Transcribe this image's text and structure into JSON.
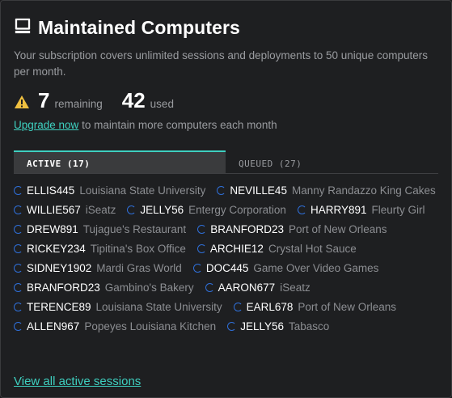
{
  "header": {
    "title": "Maintained Computers",
    "icon": "computer-icon"
  },
  "description": "Your subscription covers unlimited sessions and deployments to 50 unique computers per month.",
  "stats": {
    "remaining": "7",
    "remaining_label": "remaining",
    "used": "42",
    "used_label": "used",
    "warning_color": "#f0c040"
  },
  "upgrade": {
    "link": "Upgrade now",
    "text": " to maintain more computers each month"
  },
  "tabs": [
    {
      "label": "ACTIVE (17)"
    },
    {
      "label": "QUEUED (27)"
    }
  ],
  "accent_color": "#3ed0c0",
  "sessions": [
    {
      "name": "ELLIS445",
      "org": "Louisiana State University"
    },
    {
      "name": "NEVILLE45",
      "org": "Manny Randazzo King Cakes"
    },
    {
      "name": "WILLIE567",
      "org": "iSeatz"
    },
    {
      "name": "JELLY56",
      "org": "Entergy Corporation"
    },
    {
      "name": "HARRY891",
      "org": "Fleurty Girl"
    },
    {
      "name": "DREW891",
      "org": "Tujague's Restaurant"
    },
    {
      "name": "BRANFORD23",
      "org": "Port of New Orleans"
    },
    {
      "name": "RICKEY234",
      "org": "Tipitina's Box Office"
    },
    {
      "name": "ARCHIE12",
      "org": "Crystal Hot Sauce"
    },
    {
      "name": "SIDNEY1902",
      "org": "Mardi Gras World"
    },
    {
      "name": "DOC445",
      "org": "Game Over Video Games"
    },
    {
      "name": "BRANFORD23",
      "org": "Gambino's Bakery"
    },
    {
      "name": "AARON677",
      "org": "iSeatz"
    },
    {
      "name": "TERENCE89",
      "org": "Louisiana State University"
    },
    {
      "name": "EARL678",
      "org": "Port of New Orleans"
    },
    {
      "name": "ALLEN967",
      "org": "Popeyes Louisiana Kitchen"
    },
    {
      "name": "JELLY56",
      "org": "Tabasco"
    }
  ],
  "footer": {
    "view_all": "View all active sessions"
  }
}
